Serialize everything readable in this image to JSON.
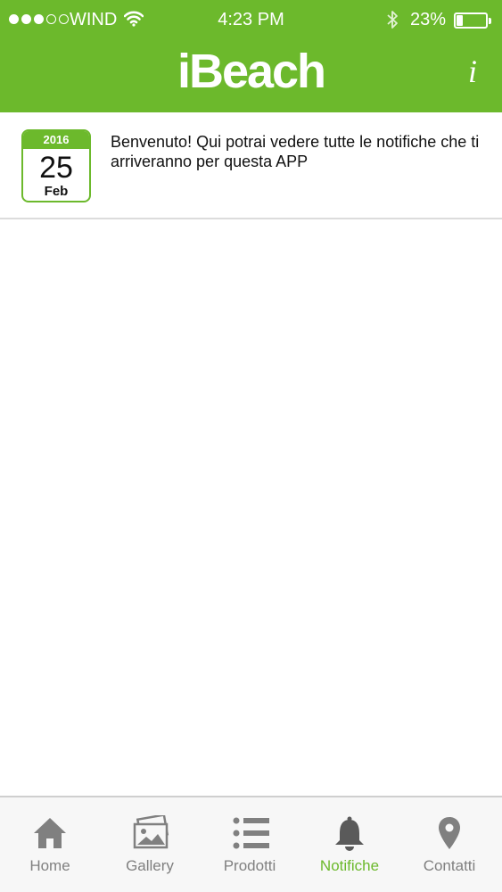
{
  "status_bar": {
    "signal_dots_filled": 3,
    "signal_dots_total": 5,
    "carrier": "WIND",
    "time": "4:23 PM",
    "battery_percent": "23%",
    "battery_level": 0.23
  },
  "header": {
    "title": "iBeach",
    "info_label": "i",
    "color": "#6cb92c"
  },
  "notifications": [
    {
      "year": "2016",
      "day": "25",
      "month": "Feb",
      "message": "Benvenuto! Qui potrai vedere tutte le notifiche che ti arriveranno per questa APP"
    }
  ],
  "tabs": [
    {
      "label": "Home",
      "icon": "home-icon",
      "active": false
    },
    {
      "label": "Gallery",
      "icon": "gallery-icon",
      "active": false
    },
    {
      "label": "Prodotti",
      "icon": "list-icon",
      "active": false
    },
    {
      "label": "Notifiche",
      "icon": "bell-icon",
      "active": true
    },
    {
      "label": "Contatti",
      "icon": "map-pin-icon",
      "active": false
    }
  ],
  "colors": {
    "accent": "#6cb92c",
    "tab_inactive": "#808080"
  }
}
